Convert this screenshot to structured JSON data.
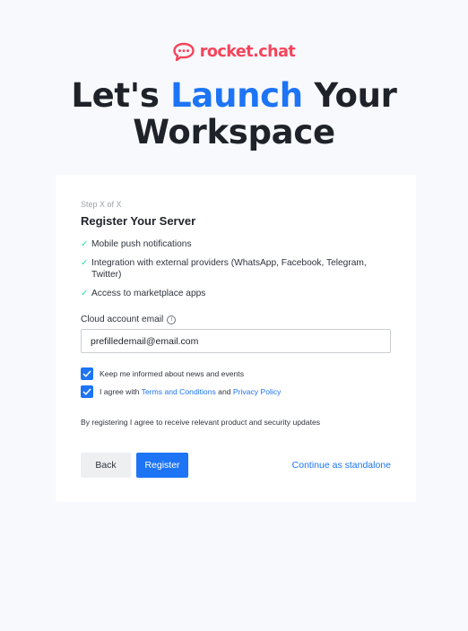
{
  "brand": {
    "name": "rocket.chat",
    "color": "#f5455c"
  },
  "headline": {
    "part1": "Let's ",
    "accent": "Launch",
    "part2": " Your",
    "line2": "Workspace"
  },
  "form": {
    "step": "Step X of X",
    "title": "Register Your Server",
    "features": [
      "Mobile push notifications",
      "Integration with external providers (WhatsApp, Facebook, Telegram, Twitter)",
      "Access to marketplace apps"
    ],
    "email_label": "Cloud account email",
    "email_value": "prefilledemail@email.com",
    "keep_informed_label": "Keep me informed about news and events",
    "keep_informed_checked": true,
    "agree_prefix": "I agree with ",
    "terms_link": "Terms and Conditions",
    "agree_and": " and ",
    "privacy_link": "Privacy Policy",
    "agree_checked": true,
    "disclaimer": "By registering I agree to receive relevant product and security updates",
    "back_label": "Back",
    "register_label": "Register",
    "standalone_label": "Continue as standalone"
  },
  "colors": {
    "accent": "#1d74f5",
    "check": "#2de0a5",
    "background": "#f7f9fd"
  }
}
